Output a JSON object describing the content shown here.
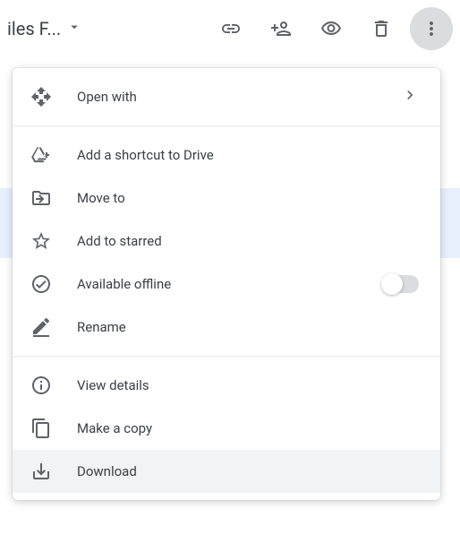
{
  "header": {
    "title": "iles F..."
  },
  "menu": {
    "open_with": "Open with",
    "add_shortcut": "Add a shortcut to Drive",
    "move_to": "Move to",
    "add_starred": "Add to starred",
    "available_offline": "Available offline",
    "rename": "Rename",
    "view_details": "View details",
    "make_copy": "Make a copy",
    "download": "Download"
  }
}
